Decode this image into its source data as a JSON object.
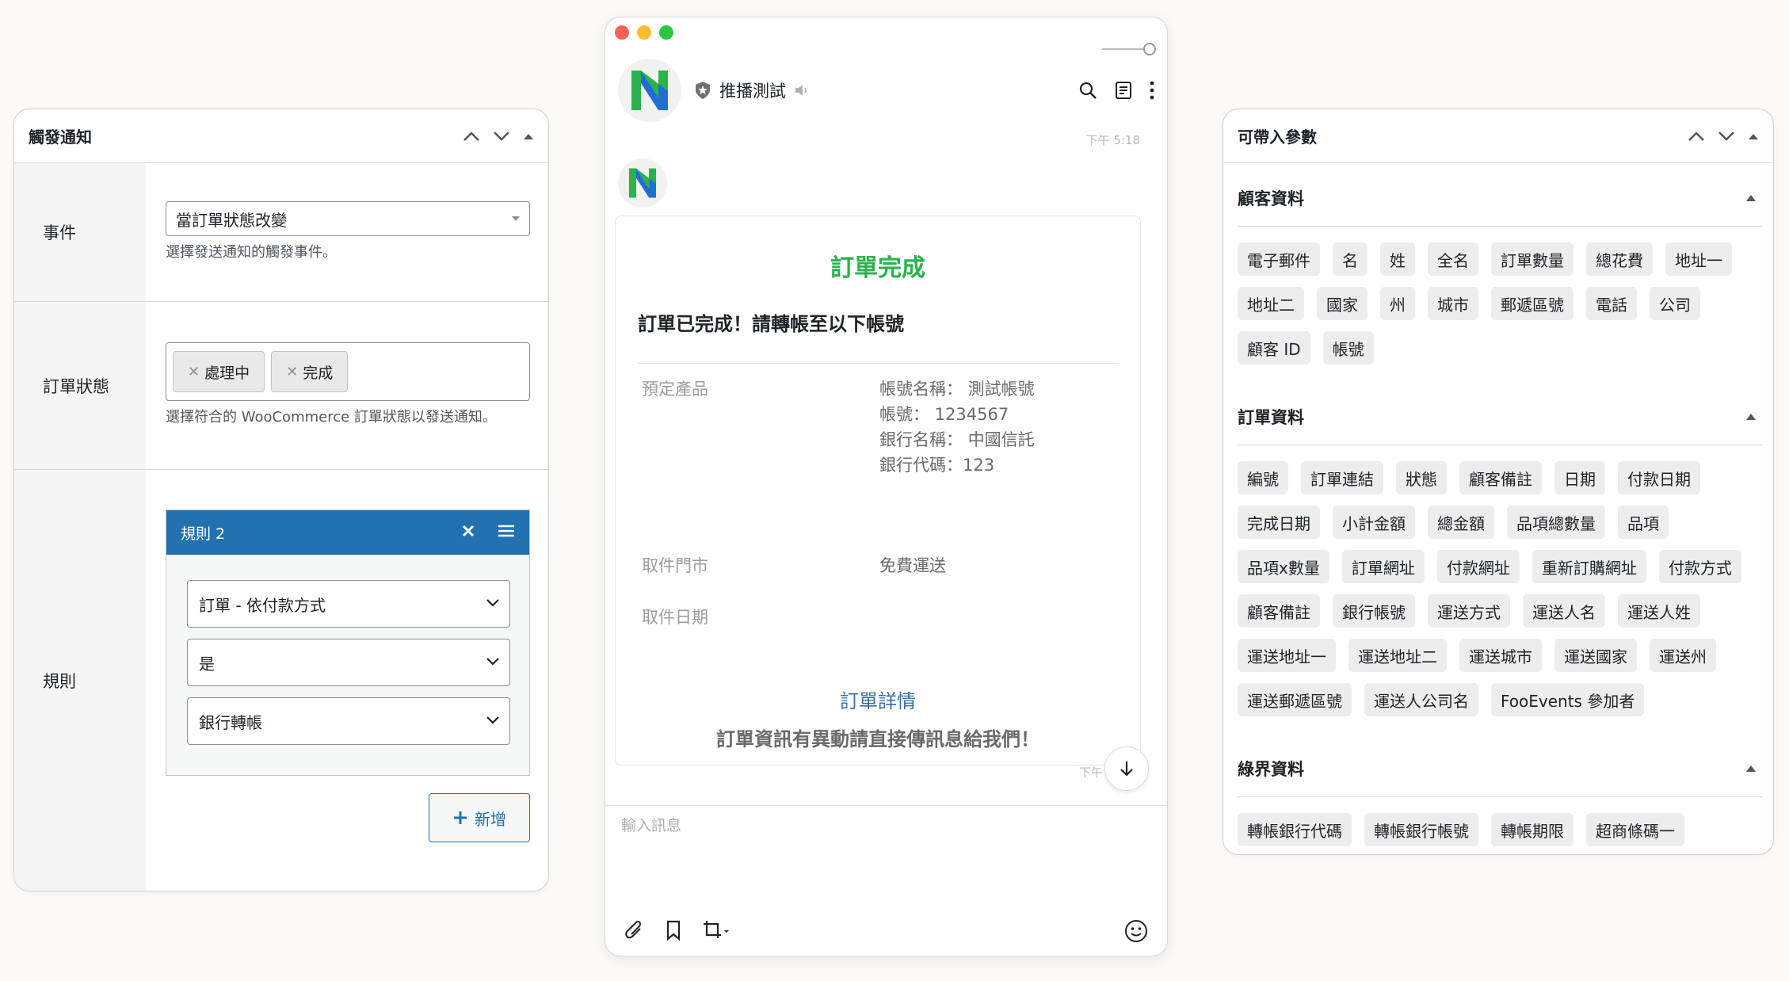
{
  "left_panel": {
    "title": "觸發通知",
    "event": {
      "label": "事件",
      "value": "當訂單狀態改變",
      "description": "選擇發送通知的觸發事件。"
    },
    "order_status": {
      "label": "訂單狀態",
      "chips": [
        "處理中",
        "完成"
      ],
      "description": "選擇符合的 WooCommerce 訂單狀態以發送通知。"
    },
    "rules": {
      "label": "規則",
      "rule_title": "規則 2",
      "dropdowns": [
        "訂單 - 依付款方式",
        "是",
        "銀行轉帳"
      ],
      "add_label": "新增"
    }
  },
  "chat": {
    "channel_name": "推播測試",
    "timestamp_top": "下午 5:18",
    "timestamp_bottom": "下午",
    "card": {
      "title": "訂單完成",
      "subtitle": "訂單已完成！請轉帳至以下帳號",
      "rows": [
        {
          "key": "預定產品",
          "values": [
            "帳號名稱： 測試帳號",
            "帳號： 1234567",
            "銀行名稱： 中國信託",
            "銀行代碼：123"
          ]
        },
        {
          "key": "取件門市",
          "values": [
            "免費運送"
          ]
        },
        {
          "key": "取件日期",
          "values": []
        }
      ],
      "link": "訂單詳情",
      "note": "訂單資訊有異動請直接傳訊息給我們！"
    },
    "input_placeholder": "輸入訊息",
    "colors": {
      "title_green": "#2bb24c",
      "link_blue": "#3a6ea5"
    }
  },
  "right_panel": {
    "title": "可帶入參數",
    "sections": [
      {
        "title": "顧客資料",
        "tags": [
          "電子郵件",
          "名",
          "姓",
          "全名",
          "訂單數量",
          "總花費",
          "地址一",
          "地址二",
          "國家",
          "州",
          "城市",
          "郵遞區號",
          "電話",
          "公司",
          "顧客 ID",
          "帳號"
        ]
      },
      {
        "title": "訂單資料",
        "tags": [
          "編號",
          "訂單連結",
          "狀態",
          "顧客備註",
          "日期",
          "付款日期",
          "完成日期",
          "小計金額",
          "總金額",
          "品項總數量",
          "品項",
          "品項x數量",
          "訂單網址",
          "付款網址",
          "重新訂購網址",
          "付款方式",
          "顧客備註",
          "銀行帳號",
          "運送方式",
          "運送人名",
          "運送人姓",
          "運送地址一",
          "運送地址二",
          "運送城市",
          "運送國家",
          "運送州",
          "運送郵遞區號",
          "運送人公司名",
          "FooEvents 參加者"
        ]
      },
      {
        "title": "綠界資料",
        "tags": [
          "轉帳銀行代碼",
          "轉帳銀行帳號",
          "轉帳期限",
          "超商條碼一"
        ]
      }
    ]
  },
  "accent_colors": {
    "wp_blue": "#2271b1",
    "close_red": "#ff5f57",
    "min_yellow": "#febc2e",
    "max_green": "#28c840"
  }
}
